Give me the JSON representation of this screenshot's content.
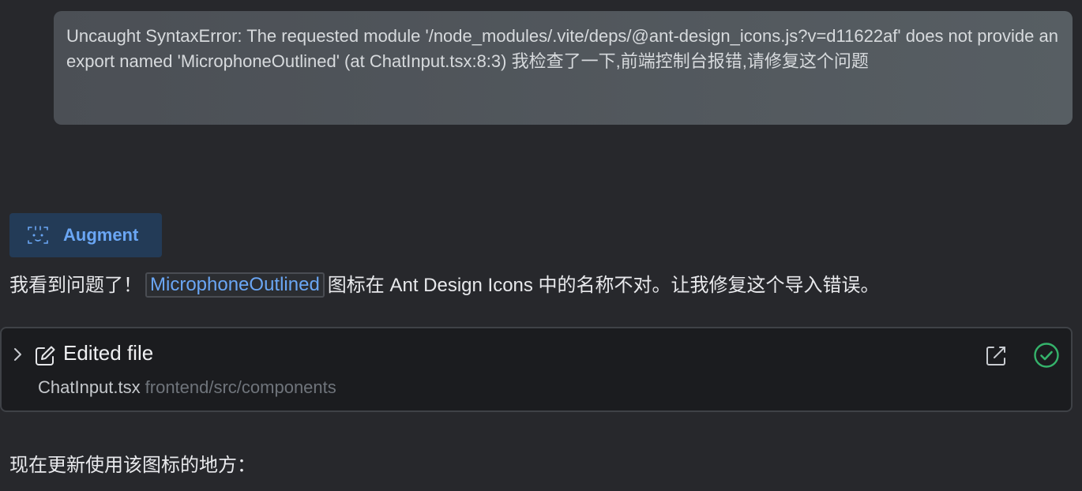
{
  "user_message": {
    "text": "Uncaught SyntaxError: The requested module '/node_modules/.vite/deps/@ant-design_icons.js?v=d11622af' does not provide an export named 'MicrophoneOutlined' (at ChatInput.tsx:8:3) 我检查了一下,前端控制台报错,请修复这个问题"
  },
  "agent": {
    "name": "Augment",
    "icon": "robot-face-icon",
    "accent_color": "#6aa6f4"
  },
  "reply": {
    "prefix": "我看到问题了！",
    "code": "MicrophoneOutlined",
    "suffix": "图标在 Ant Design Icons 中的名称不对。让我修复这个导入错误。"
  },
  "file_card": {
    "title": "Edited file",
    "file_name": "ChatInput.tsx",
    "file_path": "frontend/src/components",
    "status_color": "#35b36b",
    "icons": [
      "chevron-right-icon",
      "edit-icon",
      "open-external-icon",
      "check-circle-icon"
    ]
  },
  "followup": {
    "text": "现在更新使用该图标的地方："
  }
}
